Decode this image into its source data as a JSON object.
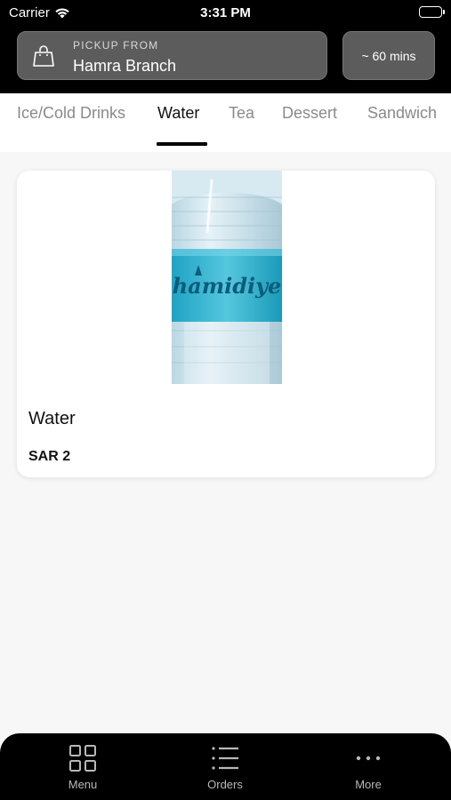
{
  "status_bar": {
    "carrier": "Carrier",
    "time": "3:31 PM"
  },
  "header": {
    "pickup_label": "PICKUP FROM",
    "branch_name": "Hamra Branch",
    "eta": "~ 60 mins"
  },
  "categories": [
    {
      "label": "Ice/Cold Drinks"
    },
    {
      "label": "Water"
    },
    {
      "label": "Tea"
    },
    {
      "label": "Dessert"
    },
    {
      "label": "Sandwich"
    }
  ],
  "active_category": "Water",
  "products": [
    {
      "name": "Water",
      "price": "SAR 2",
      "image_brand": "hamidiye"
    }
  ],
  "tab_bar": {
    "items": [
      {
        "label": "Menu",
        "icon": "grid-icon"
      },
      {
        "label": "Orders",
        "icon": "list-icon"
      },
      {
        "label": "More",
        "icon": "more-icon"
      }
    ]
  },
  "colors": {
    "header_bg": "#000000",
    "chip_bg": "#5c5c5c",
    "page_bg": "#f7f7f7",
    "card_bg": "#ffffff",
    "bottle_blue": "#3cb8d4"
  }
}
